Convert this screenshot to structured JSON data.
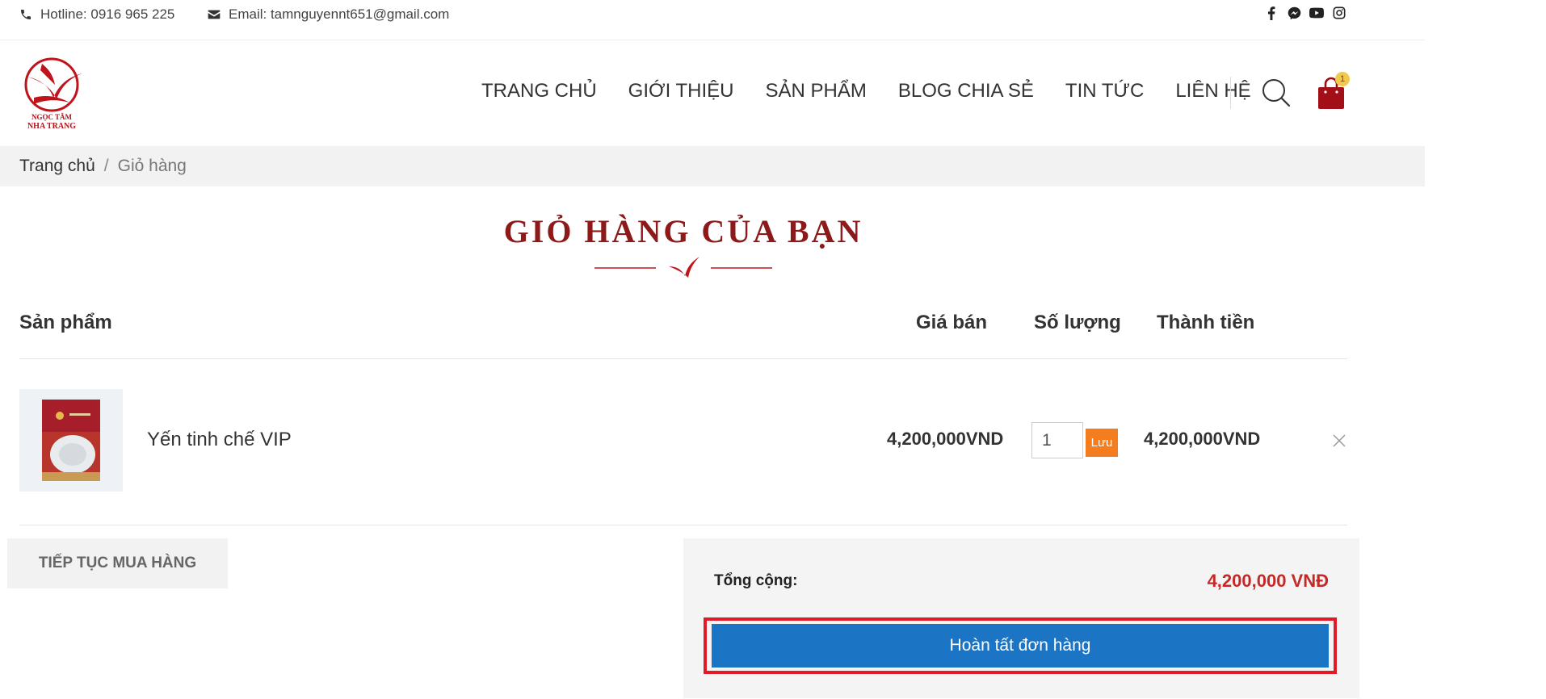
{
  "topbar": {
    "hotline": "Hotline: 0916 965 225",
    "email": "Email: tamnguyennt651@gmail.com",
    "social_icons": [
      "facebook-icon",
      "messenger-icon",
      "youtube-icon",
      "instagram-icon"
    ]
  },
  "logo": {
    "line1": "NGỌC TÂM",
    "line2": "NHA TRANG"
  },
  "nav": {
    "items": [
      "TRANG CHỦ",
      "GIỚI THIỆU",
      "SẢN PHẨM",
      "BLOG CHIA SẺ",
      "TIN TỨC",
      "LIÊN HỆ"
    ],
    "cart_count": "1"
  },
  "breadcrumb": {
    "home": "Trang chủ",
    "separator": "/",
    "current": "Giỏ hàng"
  },
  "page": {
    "title": "GIỎ HÀNG CỦA BẠN"
  },
  "table": {
    "headers": {
      "product": "Sản phẩm",
      "price": "Giá bán",
      "quantity": "Số lượng",
      "total": "Thành tiền"
    },
    "rows": [
      {
        "name": "Yến tinh chế VIP",
        "price": "4,200,000VND",
        "quantity": "1",
        "save_label": "Lưu",
        "total": "4,200,000VND"
      }
    ]
  },
  "actions": {
    "continue_shopping": "TIẾP TỤC MUA HÀNG"
  },
  "summary": {
    "label": "Tổng cộng:",
    "amount": "4,200,000 VNĐ",
    "checkout_label": "Hoàn tất đơn hàng"
  },
  "colors": {
    "brand_red": "#8c1a1a",
    "price_red": "#c62828",
    "checkout_blue": "#1b75c4",
    "save_orange": "#f47d20",
    "highlight_red": "#e01b24"
  }
}
